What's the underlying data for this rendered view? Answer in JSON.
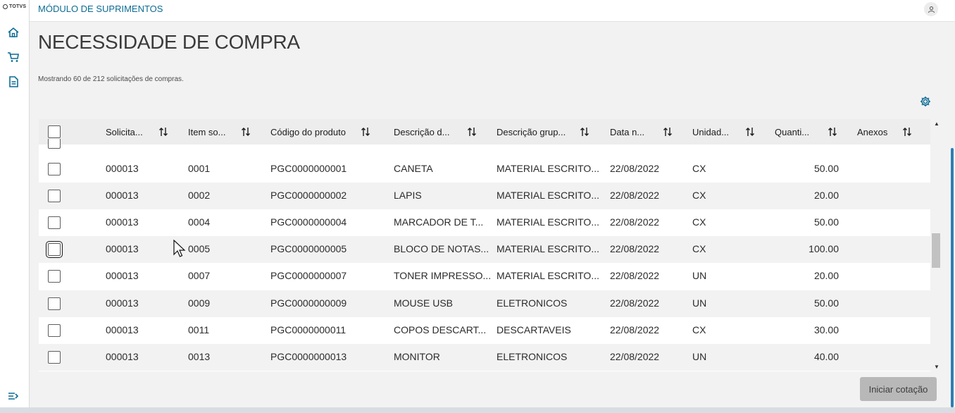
{
  "brand": {
    "logo_text": "TOTVS"
  },
  "header": {
    "module_title": "MÓDULO DE SUPRIMENTOS"
  },
  "page": {
    "title": "NECESSIDADE DE COMPRA",
    "count_text": "Mostrando 60 de 212 solicitações de compras."
  },
  "table": {
    "columns": [
      "Solicita...",
      "Item so...",
      "Código do produto",
      "Descrição d...",
      "Descrição grup...",
      "Data n...",
      "Unidad...",
      "Quanti...",
      "Anexos"
    ],
    "rows": [
      {
        "solicitacao": "000013",
        "item": "0001",
        "codigo": "PGC0000000001",
        "descricao": "CANETA",
        "grupo": "MATERIAL ESCRITO...",
        "data": "22/08/2022",
        "unidade": "CX",
        "quantidade": "50.00"
      },
      {
        "solicitacao": "000013",
        "item": "0002",
        "codigo": "PGC0000000002",
        "descricao": "LAPIS",
        "grupo": "MATERIAL ESCRITO...",
        "data": "22/08/2022",
        "unidade": "CX",
        "quantidade": "20.00"
      },
      {
        "solicitacao": "000013",
        "item": "0004",
        "codigo": "PGC0000000004",
        "descricao": "MARCADOR DE T...",
        "grupo": "MATERIAL ESCRITO...",
        "data": "22/08/2022",
        "unidade": "CX",
        "quantidade": "50.00"
      },
      {
        "solicitacao": "000013",
        "item": "0005",
        "codigo": "PGC0000000005",
        "descricao": "BLOCO DE NOTAS...",
        "grupo": "MATERIAL ESCRITO...",
        "data": "22/08/2022",
        "unidade": "CX",
        "quantidade": "100.00"
      },
      {
        "solicitacao": "000013",
        "item": "0007",
        "codigo": "PGC0000000007",
        "descricao": "TONER IMPRESSO...",
        "grupo": "MATERIAL ESCRITO...",
        "data": "22/08/2022",
        "unidade": "UN",
        "quantidade": "20.00"
      },
      {
        "solicitacao": "000013",
        "item": "0009",
        "codigo": "PGC0000000009",
        "descricao": "MOUSE USB",
        "grupo": "ELETRONICOS",
        "data": "22/08/2022",
        "unidade": "UN",
        "quantidade": "50.00"
      },
      {
        "solicitacao": "000013",
        "item": "0011",
        "codigo": "PGC0000000011",
        "descricao": "COPOS DESCART...",
        "grupo": "DESCARTAVEIS",
        "data": "22/08/2022",
        "unidade": "CX",
        "quantidade": "30.00"
      },
      {
        "solicitacao": "000013",
        "item": "0013",
        "codigo": "PGC0000000013",
        "descricao": "MONITOR",
        "grupo": "ELETRONICOS",
        "data": "22/08/2022",
        "unidade": "UN",
        "quantidade": "40.00"
      }
    ]
  },
  "actions": {
    "start_quote": "Iniciar cotação"
  },
  "icons": {
    "nav": [
      "home-icon",
      "cart-icon",
      "document-icon",
      "menu-collapse-icon"
    ],
    "header": [
      "user-icon"
    ],
    "table": [
      "gear-icon",
      "sort-icon"
    ]
  },
  "colors": {
    "accent": "#0c6c94",
    "button_disabled": "#b8b8b8"
  }
}
